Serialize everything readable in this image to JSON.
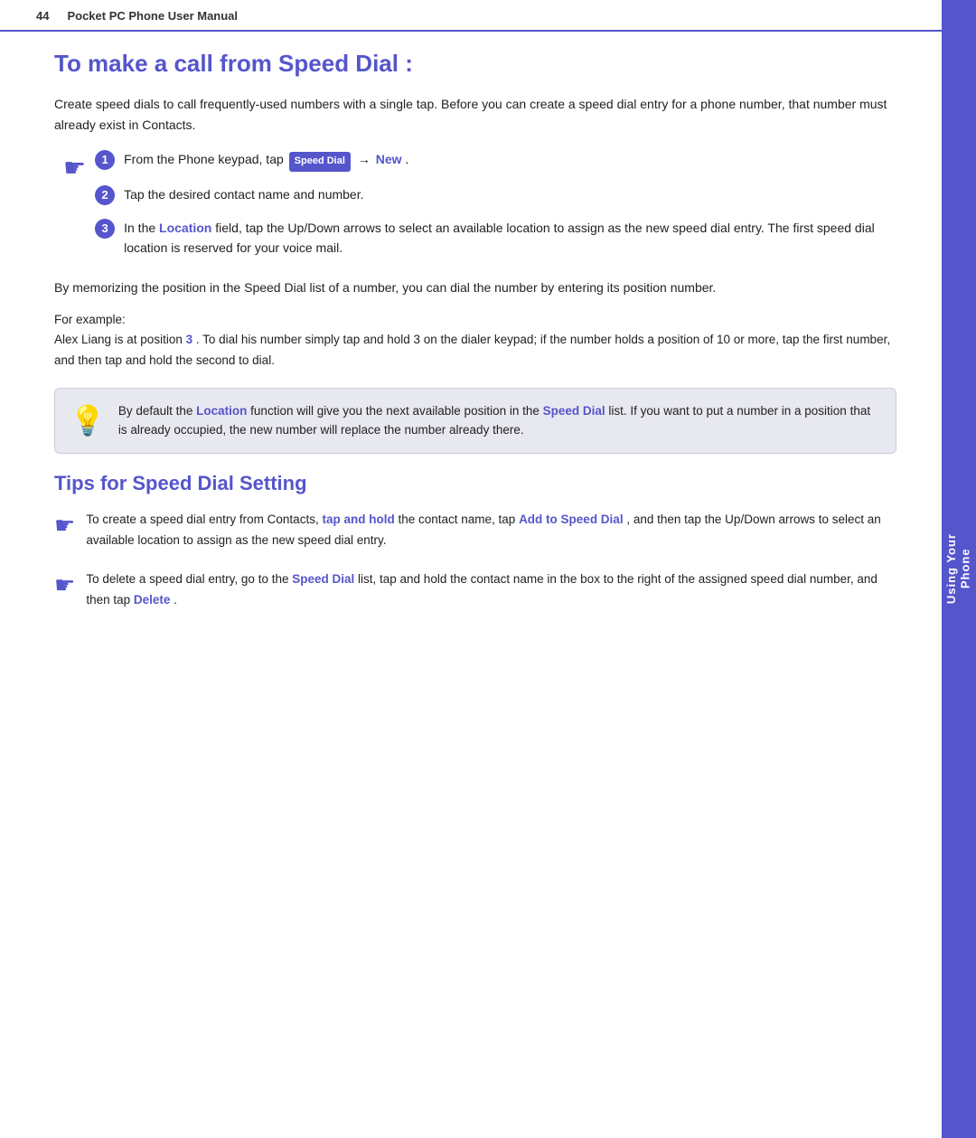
{
  "header": {
    "page_number": "44",
    "title": "Pocket PC Phone User Manual"
  },
  "side_tab": {
    "line1": "Using Your",
    "line2": "Phone"
  },
  "section1": {
    "heading": "To make a call from Speed Dial :",
    "intro": "Create speed dials to call frequently-used numbers with a single tap. Before you can create a speed dial entry for a phone number, that number must already exist in Contacts.",
    "steps": [
      {
        "number": "1",
        "text_before": "From the Phone keypad, tap",
        "button_label": "Speed Dial",
        "arrow": "→",
        "link_text": "New",
        "text_after": "."
      },
      {
        "number": "2",
        "text": "Tap the desired contact name and number."
      },
      {
        "number": "3",
        "text_parts": [
          "In the ",
          "Location",
          " field, tap the Up/Down arrows to select an available location to assign as the new speed dial entry. The first speed dial location is reserved for your voice mail."
        ]
      }
    ]
  },
  "position_text": {
    "main": "By memorizing the position in the Speed Dial list of a number, you can dial the number by entering its position number.",
    "for_example": "For example:",
    "example_detail": "Alex Liang is at position",
    "position_number": "3",
    "example_rest": ". To dial his number simply tap and hold 3 on the dialer keypad; if the number holds a position of 10 or more, tap the first number, and then tap and hold the second to dial."
  },
  "info_box": {
    "text_parts": [
      "By default the ",
      "Location",
      " function will give you the next available position in the ",
      "Speed Dial",
      " list. If you want to put a number in a position that is already occupied, the new number will replace the number already there."
    ]
  },
  "section2": {
    "heading": "Tips for Speed Dial Setting",
    "tips": [
      {
        "text_parts": [
          "To create a speed dial entry from Contacts, ",
          "tap and hold",
          " the contact name, tap ",
          "Add to Speed Dial",
          ", and then tap the Up/Down arrows to select an available location to assign as the new speed dial entry."
        ]
      },
      {
        "text_parts": [
          "To delete a speed dial entry, go to the ",
          "Speed Dial",
          " list, tap and hold the contact name in the box to the right of the assigned speed dial number, and then tap ",
          "Delete",
          "."
        ]
      }
    ]
  }
}
